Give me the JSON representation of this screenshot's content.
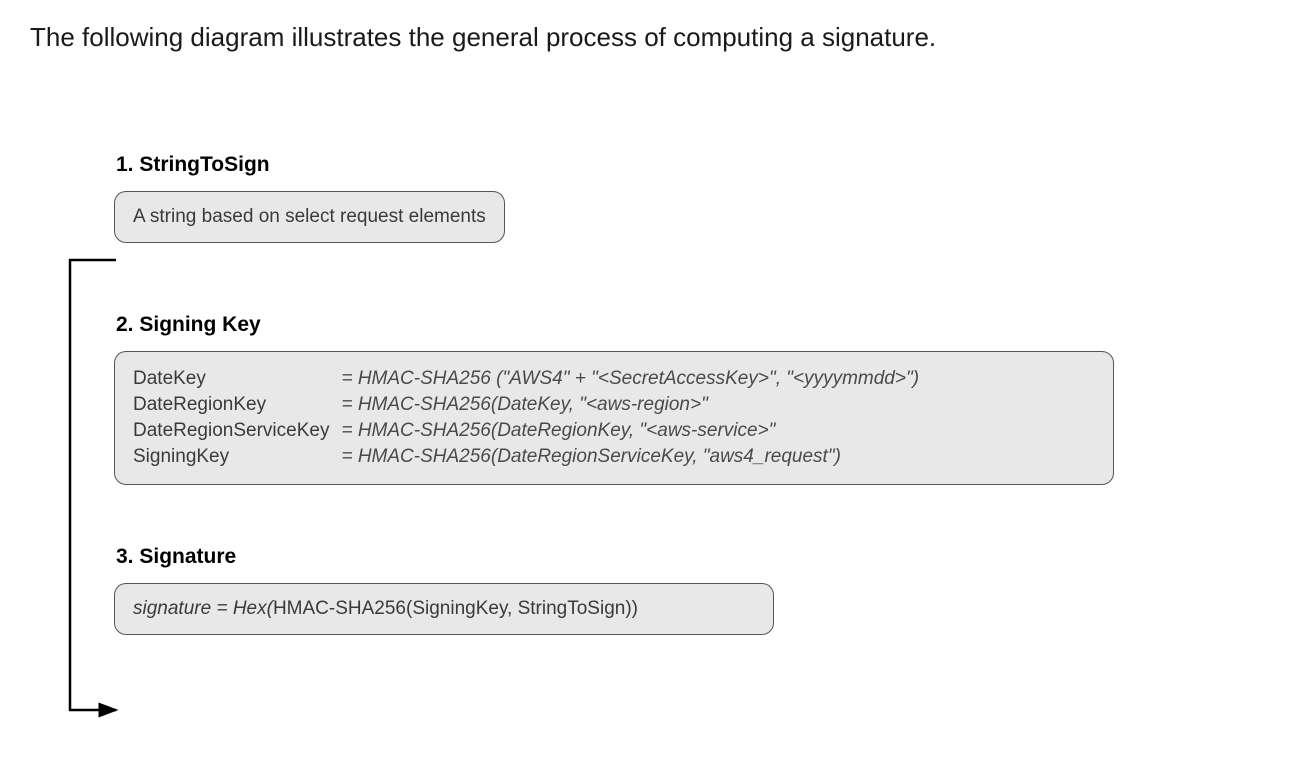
{
  "intro": "The following diagram illustrates the general process of computing a signature.",
  "section1": {
    "title": "1. StringToSign",
    "box": "A string based on select request elements"
  },
  "section2": {
    "title": "2. Signing Key",
    "rows": [
      {
        "key": "DateKey",
        "val": "= HMAC-SHA256 (\"AWS4\" + \"<SecretAccessKey>\", \"<yyyymmdd>\")"
      },
      {
        "key": "DateRegionKey",
        "val": "= HMAC-SHA256(DateKey, \"<aws-region>\""
      },
      {
        "key": "DateRegionServiceKey",
        "val": "= HMAC-SHA256(DateRegionKey, \"<aws-service>\""
      },
      {
        "key": "SigningKey",
        "val": "= HMAC-SHA256(DateRegionServiceKey, \"aws4_request\")"
      }
    ]
  },
  "section3": {
    "title": "3. Signature",
    "line_lhs": "signature = ",
    "line_fn1": "Hex(",
    "line_mid": "HMAC-SHA256(",
    "line_args": "SigningKey, StringToSign",
    "line_close": "))"
  }
}
